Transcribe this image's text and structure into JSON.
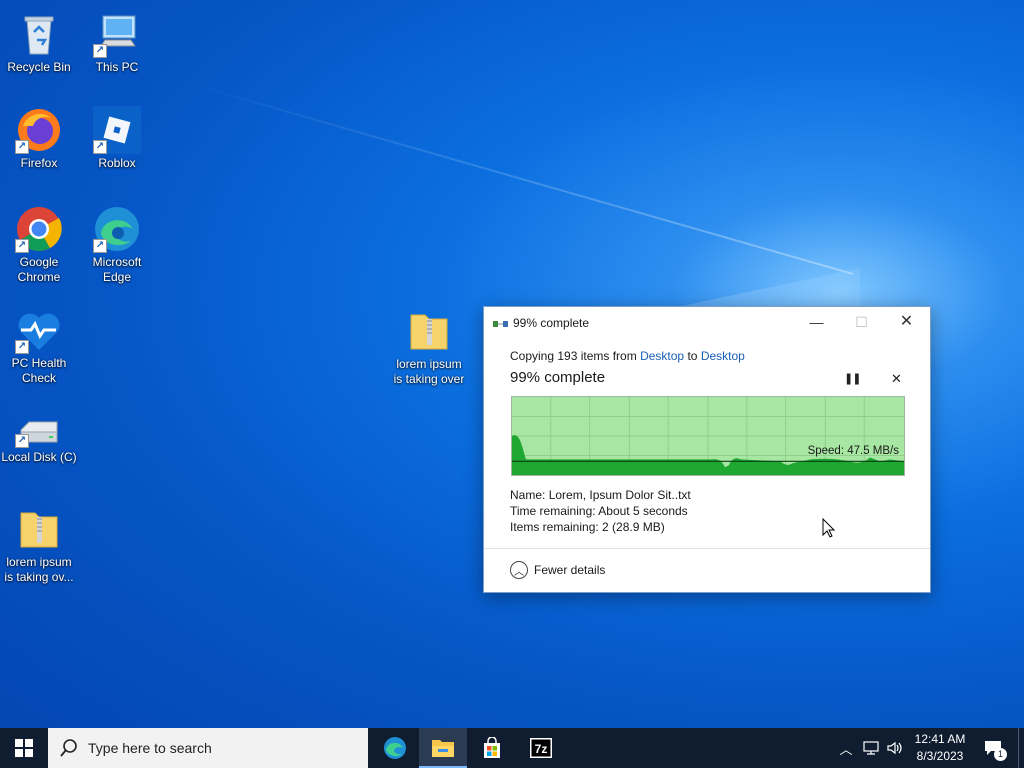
{
  "desktop": {
    "icons": [
      {
        "label": "Recycle Bin"
      },
      {
        "label": "This PC"
      },
      {
        "label": "Firefox"
      },
      {
        "label": "Roblox"
      },
      {
        "label": "Google Chrome"
      },
      {
        "label": "Microsoft Edge"
      },
      {
        "label": "PC Health Check"
      },
      {
        "label": "Local Disk (C)"
      },
      {
        "label": "lorem ipsum is taking ov..."
      },
      {
        "label": "lorem ipsum is taking over"
      }
    ]
  },
  "dialog": {
    "title": "99% complete",
    "copy_prefix": "Copying 193 items from",
    "source": "Desktop",
    "to_word": "to",
    "destination": "Desktop",
    "heading": "99% complete",
    "progress_percent": 99,
    "speed": "Speed: 47.5 MB/s",
    "name_label": "Name:",
    "name_value": "Lorem, Ipsum Dolor Sit..txt",
    "time_label": "Time remaining:",
    "time_value": "About 5 seconds",
    "items_label": "Items remaining:",
    "items_value": "2 (28.9 MB)",
    "fewer_details": "Fewer details"
  },
  "taskbar": {
    "search_placeholder": "Type here to search",
    "time": "12:41 AM",
    "date": "8/3/2023",
    "notification_count": "1",
    "apps": [
      "edge-icon",
      "file-explorer-icon",
      "store-icon",
      "7zip-icon"
    ]
  },
  "colors": {
    "graph_bg": "#a8e6a3",
    "graph_fill": "#1ea832",
    "taskbar": "#101d30",
    "link": "#1a5fb4"
  }
}
